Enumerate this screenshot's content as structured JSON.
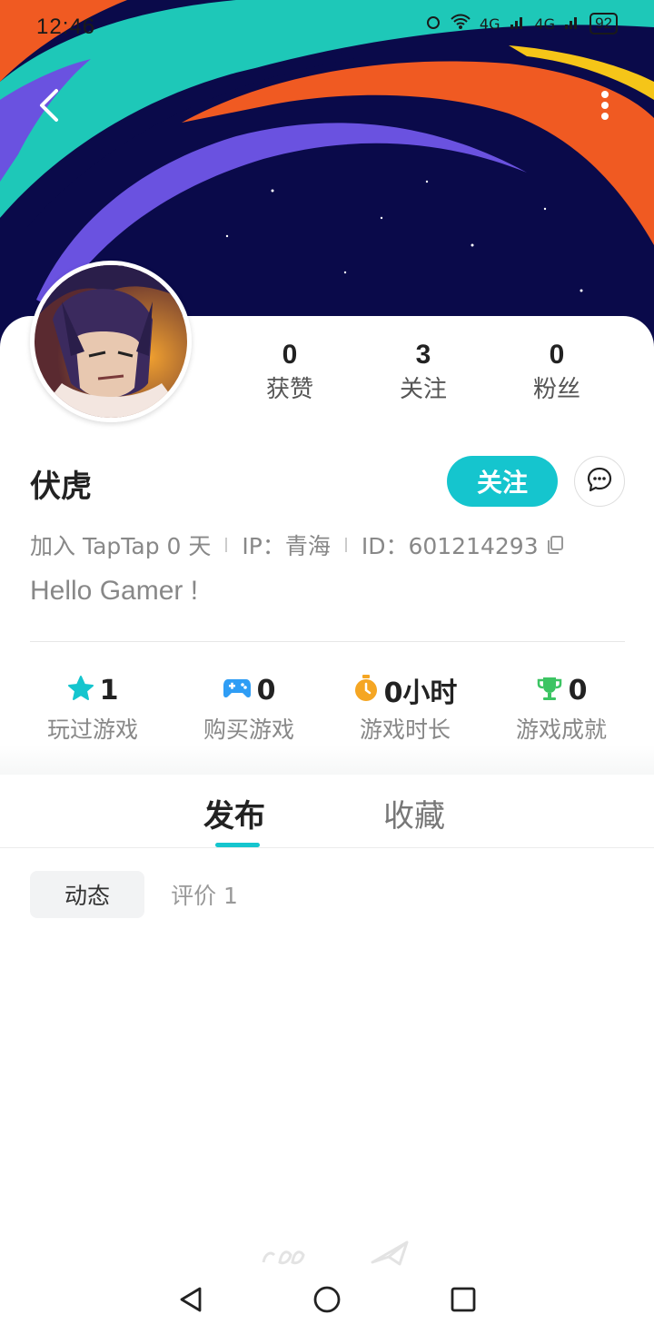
{
  "status_bar": {
    "time": "12:46",
    "network_1": "4G",
    "network_2": "4G",
    "battery": "92"
  },
  "profile": {
    "username": "伏虎",
    "follow_label": "关注",
    "stats": [
      {
        "value": "0",
        "label": "获赞"
      },
      {
        "value": "3",
        "label": "关注"
      },
      {
        "value": "0",
        "label": "粉丝"
      }
    ],
    "joined": "加入 TapTap 0 天",
    "ip": "IP：青海",
    "id": "ID：601214293",
    "bio": "Hello Gamer !"
  },
  "game_stats": [
    {
      "value": "1",
      "label": "玩过游戏",
      "icon": "star-icon",
      "color": "#15c5ce"
    },
    {
      "value": "0",
      "label": "购买游戏",
      "icon": "gamepad-icon",
      "color": "#2e9df5"
    },
    {
      "value": "0小时",
      "label": "游戏时长",
      "icon": "stopwatch-icon",
      "color": "#f5a623"
    },
    {
      "value": "0",
      "label": "游戏成就",
      "icon": "trophy-icon",
      "color": "#3cc463"
    }
  ],
  "tabs": [
    {
      "label": "发布",
      "active": true
    },
    {
      "label": "收藏",
      "active": false
    }
  ],
  "sub_tabs": [
    {
      "label": "动态",
      "active": true
    },
    {
      "label": "评价 1",
      "active": false
    }
  ],
  "colors": {
    "accent": "#15c5ce",
    "banner_bg": "#0a0a4a"
  }
}
